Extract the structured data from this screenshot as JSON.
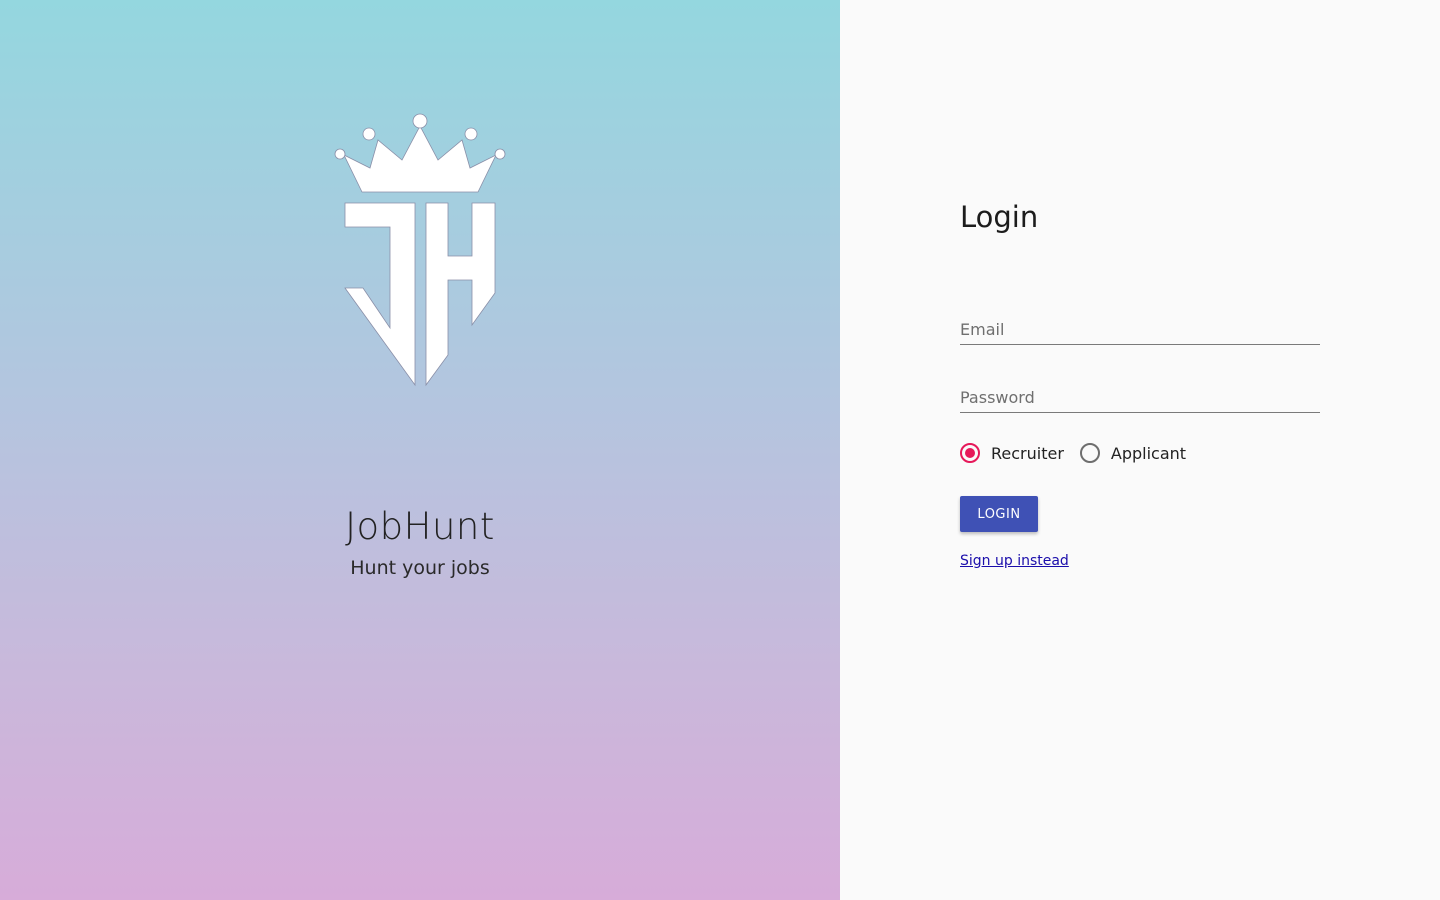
{
  "brand": {
    "logo_icon": "crown-jh-logo-icon",
    "logo_text": "JH",
    "name": "JobHunt",
    "tagline": "Hunt your jobs"
  },
  "login": {
    "title": "Login",
    "email": {
      "value": "",
      "placeholder": "Email"
    },
    "password": {
      "value": "",
      "placeholder": "Password"
    },
    "role_options": [
      {
        "label": "Recruiter",
        "selected": true
      },
      {
        "label": "Applicant",
        "selected": false
      }
    ],
    "submit_label": "LOGIN",
    "signup_link": "Sign up instead"
  },
  "colors": {
    "accent": "#3f51b5",
    "radio_selected": "#e6195a",
    "link": "#1a0dab",
    "gradient_top": "#94d7df",
    "gradient_bottom": "#d7acd9"
  }
}
